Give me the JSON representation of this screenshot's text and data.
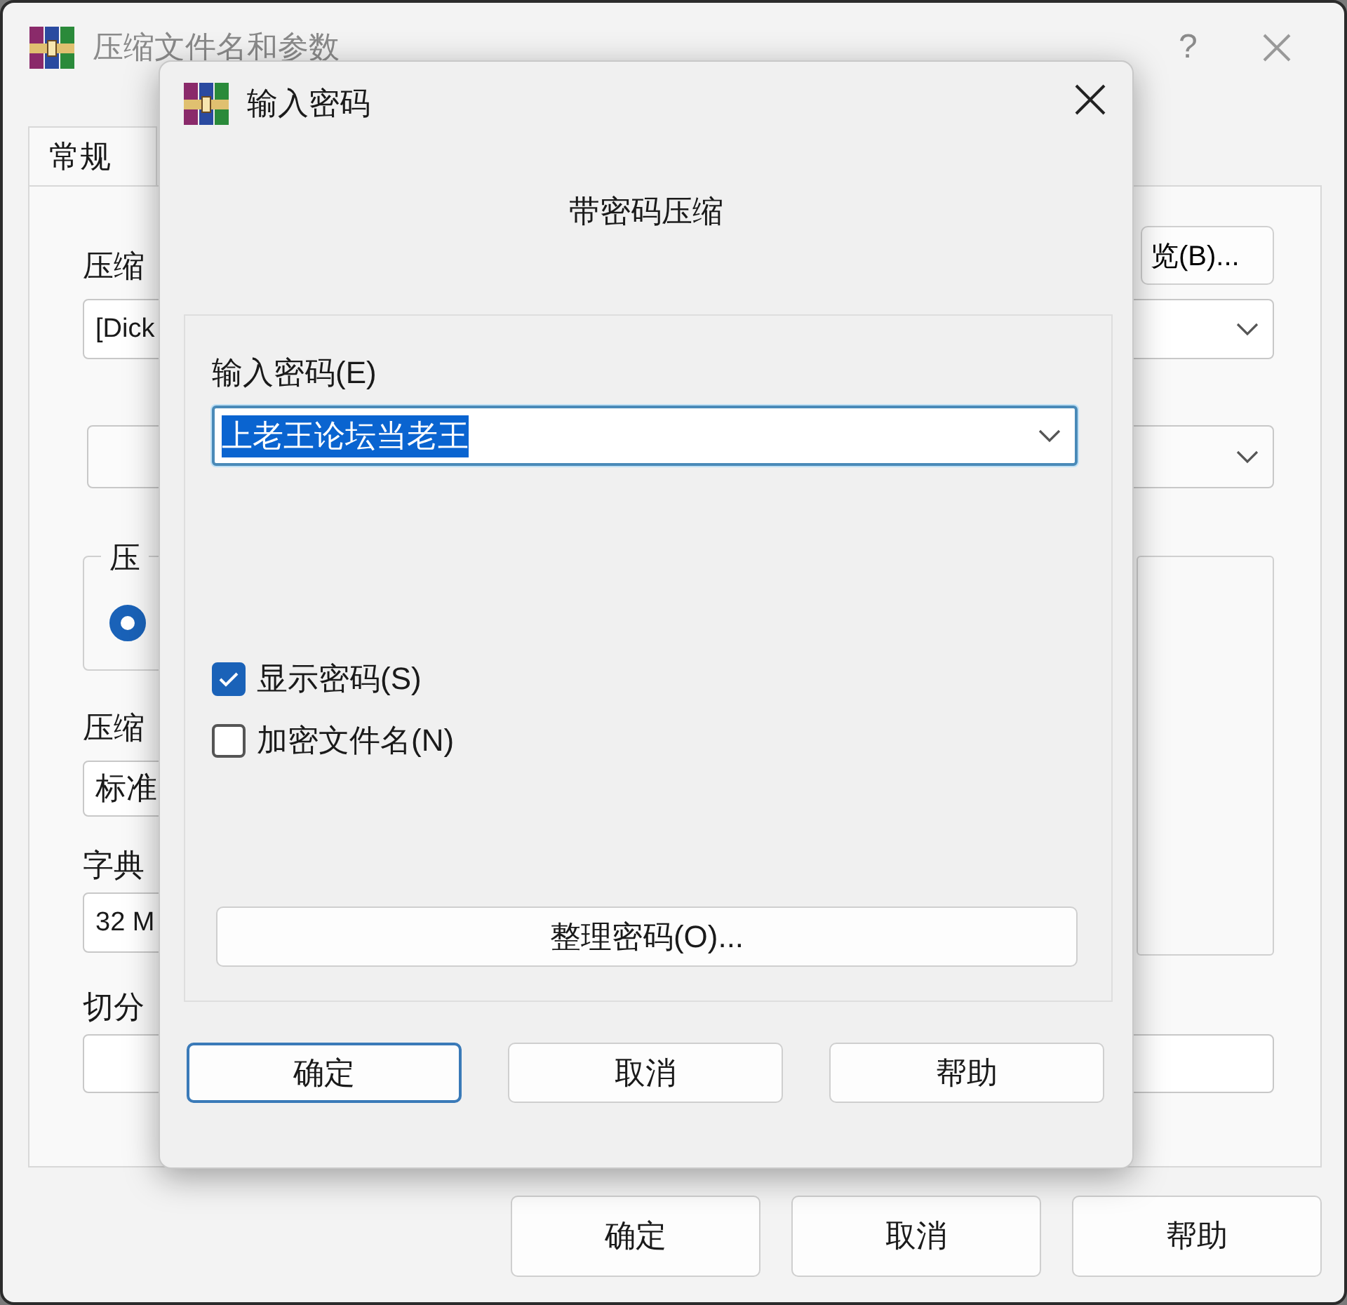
{
  "main_window": {
    "title": "压缩文件名和参数",
    "help_button": "?",
    "tabs": [
      {
        "label": "常规",
        "selected": true
      }
    ],
    "archive_name_label": "压缩",
    "archive_name_value": "[Dick",
    "browse_button": "览(B)...",
    "format_group_label": "压",
    "format_radio_selected": true,
    "method_label": "压缩",
    "method_value": "标准",
    "dictionary_label": "字典",
    "dictionary_value": "32 M",
    "split_label": "切分",
    "buttons": [
      "确定",
      "取消",
      "帮助"
    ]
  },
  "password_dialog": {
    "title": "输入密码",
    "heading": "带密码压缩",
    "password_label": "输入密码(E)",
    "password_value": "上老王论坛当老王",
    "password_selected": true,
    "options": [
      {
        "label": "显示密码(S)",
        "checked": true
      },
      {
        "label": "加密文件名(N)",
        "checked": false
      }
    ],
    "organize_button": "整理密码(O)...",
    "buttons": [
      {
        "label": "确定",
        "default": true
      },
      {
        "label": "取消",
        "default": false
      },
      {
        "label": "帮助",
        "default": false
      }
    ]
  }
}
